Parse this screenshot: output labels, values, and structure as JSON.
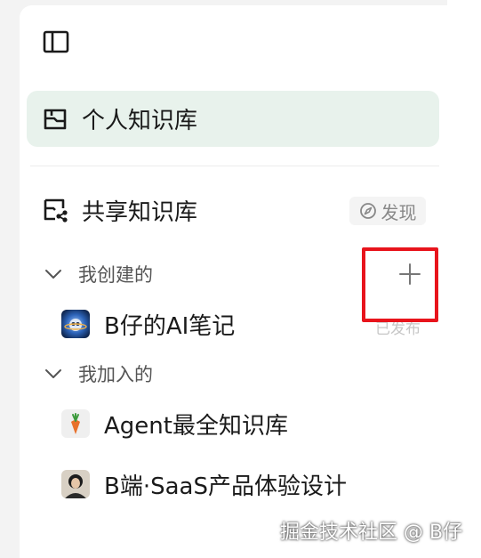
{
  "sidebar": {
    "personal_kb": {
      "label": "个人知识库",
      "icon": "personal-library-icon"
    },
    "shared_kb": {
      "label": "共享知识库",
      "icon": "shared-library-icon"
    },
    "discover": {
      "label": "发现",
      "icon": "compass-icon"
    },
    "created_section": {
      "label": "我创建的",
      "icon": "chevron-down-icon"
    },
    "created_items": [
      {
        "label": "B仔的AI笔记",
        "avatar": "blue-planet-avatar"
      }
    ],
    "published_status": "已发布",
    "joined_section": {
      "label": "我加入的",
      "icon": "chevron-down-icon"
    },
    "joined_items": [
      {
        "label": "Agent最全知识库",
        "avatar": "carrot-avatar"
      },
      {
        "label": "B端·SaaS产品体验设计",
        "avatar": "person-avatar"
      }
    ]
  },
  "watermark": "掘金技术社区 @ B仔",
  "colors": {
    "active_bg": "#e8f2ec",
    "highlight": "#e8141c"
  }
}
